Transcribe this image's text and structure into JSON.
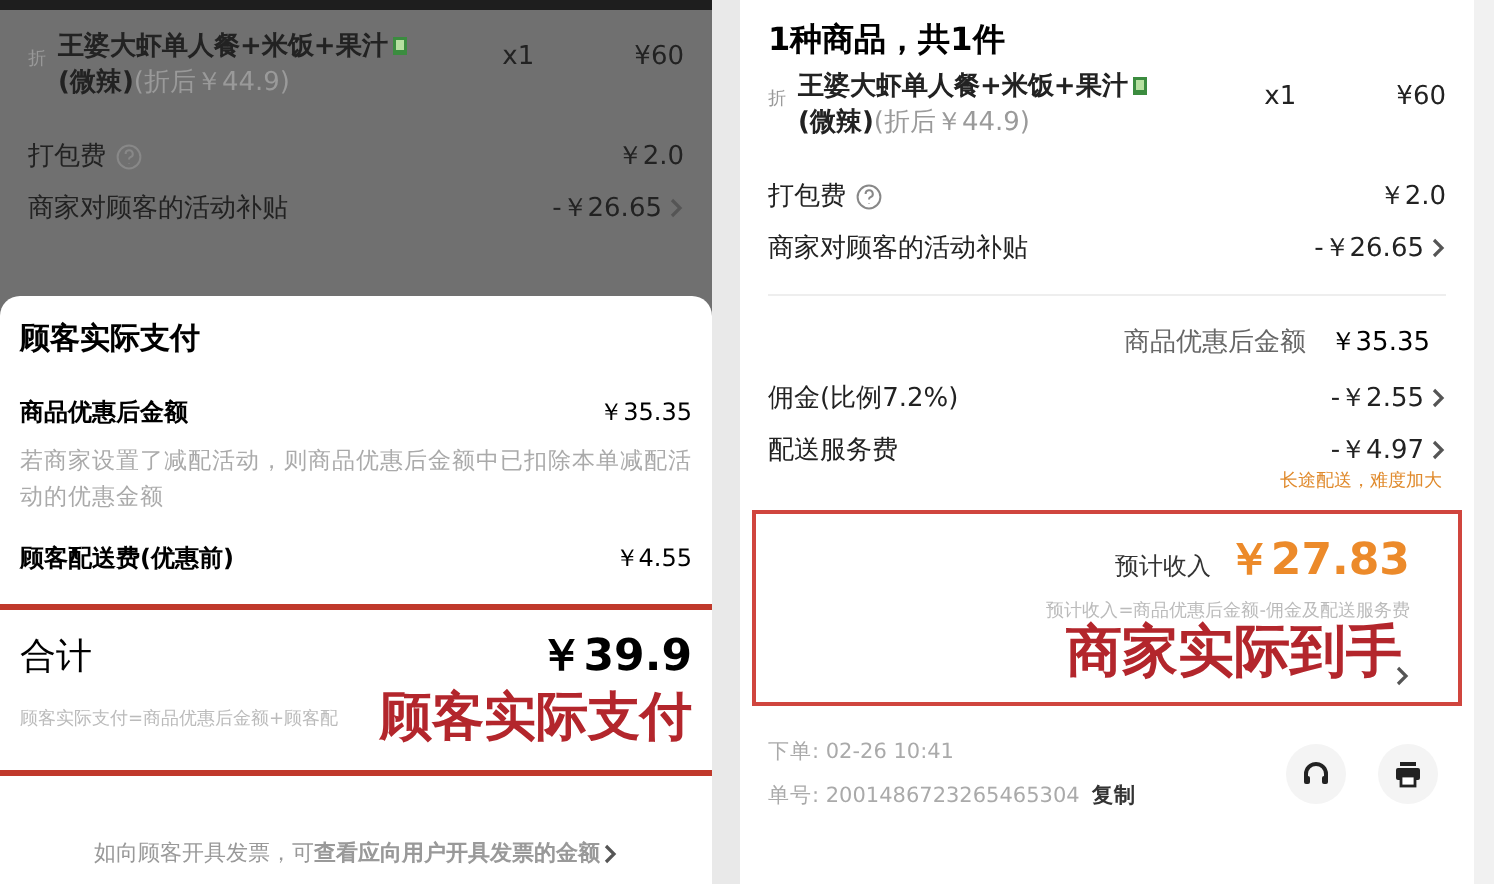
{
  "left": {
    "item": {
      "tag": "折",
      "name": "王婆大虾单人餐+米饭+果汁",
      "spec": "(微辣)",
      "discounted": "(折后￥44.9)",
      "qty": "x1",
      "price": "¥60"
    },
    "fees": [
      {
        "label": "打包费",
        "help": true,
        "amount": "￥2.0",
        "chevron": false
      },
      {
        "label": "商家对顾客的活动补贴",
        "help": false,
        "amount": "-￥26.65",
        "chevron": true
      }
    ],
    "sheet": {
      "title": "顾客实际支付",
      "rows": [
        {
          "label": "商品优惠后金额",
          "amount": "￥35.35",
          "note": "若商家设置了减配活动，则商品优惠后金额中已扣除本单减配活动的优惠金额"
        },
        {
          "label": "顾客配送费(优惠前)",
          "amount": "￥4.55"
        }
      ],
      "total": {
        "label": "合计",
        "amount": "￥39.9",
        "formula": "顾客实际支付=商品优惠后金额+顾客配",
        "annotation": "顾客实际支付"
      },
      "footer": "如向顾客开具发票，可**查看应向用户开具发票的金额**"
    }
  },
  "right": {
    "heading": "1种商品，共1件",
    "item": {
      "tag": "折",
      "name": "王婆大虾单人餐+米饭+果汁",
      "spec": "(微辣)",
      "discounted": "(折后￥44.9)",
      "qty": "x1",
      "price": "¥60"
    },
    "fees": [
      {
        "label": "打包费",
        "help": true,
        "amount": "￥2.0",
        "chevron": false
      },
      {
        "label": "商家对顾客的活动补贴",
        "help": false,
        "amount": "-￥26.65",
        "chevron": true
      }
    ],
    "subtotal": {
      "label": "商品优惠后金额",
      "amount": "￥35.35"
    },
    "deductions": [
      {
        "label": "佣金(比例7.2%)",
        "amount": "-￥2.55",
        "chevron": true
      },
      {
        "label": "配送服务费",
        "amount": "-￥4.97",
        "chevron": true,
        "note": "长途配送，难度加大"
      }
    ],
    "income": {
      "label": "预计收入",
      "amount": "￥27.83",
      "formula": "预计收入=商品优惠后金额-佣金及配送服务费",
      "annotation": "商家实际到手"
    },
    "order": {
      "time": "下单: 02-26 10:41",
      "number": "单号: 2001486723265465304",
      "copy": "复制"
    }
  }
}
